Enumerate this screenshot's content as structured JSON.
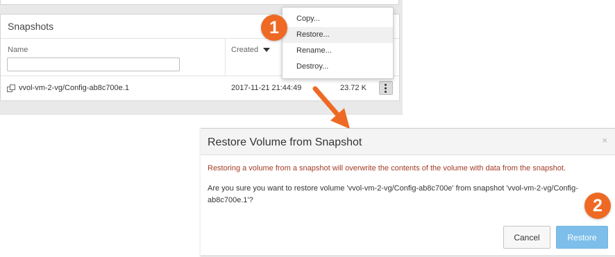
{
  "panel": {
    "title": "Snapshots",
    "columns": {
      "name": "Name",
      "created": "Created"
    },
    "filter": {
      "value": "",
      "placeholder": ""
    },
    "row": {
      "name": "vvol-vm-2-vg/Config-ab8c700e.1",
      "created": "2017-11-21 21:44:49",
      "size": "23.72 K"
    }
  },
  "context_menu": {
    "items": [
      "Copy...",
      "Restore...",
      "Rename...",
      "Destroy..."
    ],
    "active_index": 1
  },
  "callouts": {
    "step1": "1",
    "step2": "2"
  },
  "dialog": {
    "title": "Restore Volume from Snapshot",
    "close": "×",
    "warning": "Restoring a volume from a snapshot will overwrite the contents of the volume with data from the snapshot.",
    "question": "Are you sure you want to restore volume 'vvol-vm-2-vg/Config-ab8c700e' from snapshot 'vvol-vm-2-vg/Config-ab8c700e.1'?",
    "cancel_label": "Cancel",
    "restore_label": "Restore"
  },
  "colors": {
    "callout": "#ee6a24",
    "warning_text": "#a33b25",
    "primary_button": "#7dbfea"
  },
  "icons": [
    "sort-desc-icon",
    "snapshot-icon",
    "kebab-menu-icon",
    "close-icon",
    "arrow-icon"
  ]
}
